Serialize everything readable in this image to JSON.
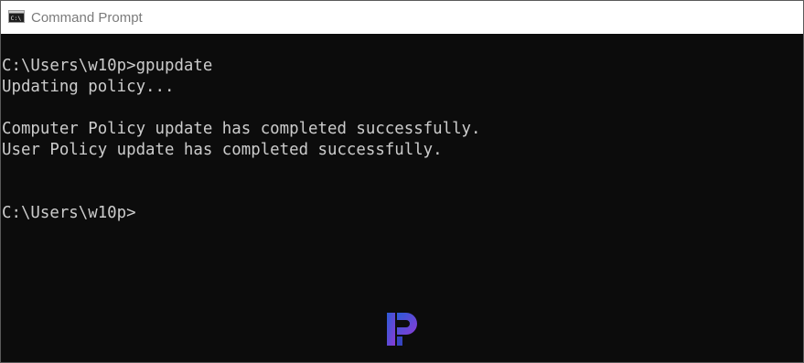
{
  "window": {
    "title": "Command Prompt",
    "icon": "cmd-console-icon"
  },
  "console": {
    "lines": [
      "C:\\Users\\w10p>gpupdate",
      "Updating policy...",
      "",
      "Computer Policy update has completed successfully.",
      "User Policy update has completed successfully.",
      "",
      "",
      "C:\\Users\\w10p>"
    ],
    "text_color": "#cccccc",
    "background_color": "#0c0c0c"
  },
  "watermark": {
    "icon": "prajwal-p-logo-icon",
    "colors": [
      "#2b5bd7",
      "#8a3bd6"
    ]
  }
}
